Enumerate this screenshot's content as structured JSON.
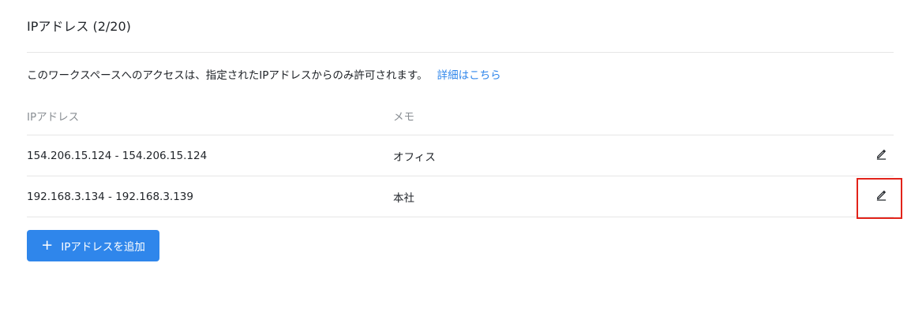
{
  "section": {
    "title": "IPアドレス (2/20)"
  },
  "description": {
    "text": "このワークスペースへのアクセスは、指定されたIPアドレスからのみ許可されます。",
    "link": "詳細はこちら"
  },
  "table": {
    "headers": {
      "ip": "IPアドレス",
      "memo": "メモ"
    },
    "rows": [
      {
        "ip": "154.206.15.124 - 154.206.15.124",
        "memo": "オフィス",
        "action_icon": "pencil-icon"
      },
      {
        "ip": "192.168.3.134 - 192.168.3.139",
        "memo": "本社",
        "action_icon": "pencil-icon"
      }
    ]
  },
  "add_button": {
    "icon": "plus",
    "label": "IPアドレスを追加"
  },
  "colors": {
    "accent": "#2f86eb",
    "highlight": "#e2231a",
    "divider": "#e6e6e6",
    "muted_text": "#8a8f94"
  }
}
